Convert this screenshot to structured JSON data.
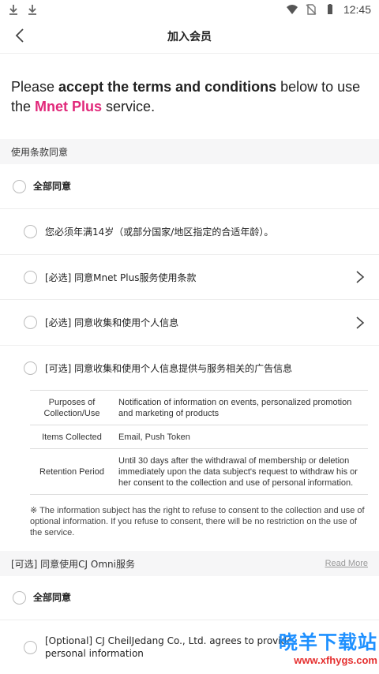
{
  "status_bar": {
    "time": "12:45",
    "left_icons": [
      "download-icon",
      "download-icon"
    ],
    "right_icons": [
      "wifi-icon",
      "no-sim-icon",
      "battery-icon"
    ]
  },
  "header": {
    "title": "加入会员",
    "back_icon": "chevron-left-icon"
  },
  "intro": {
    "part1": "Please ",
    "part2": "accept the terms and conditions",
    "part3": " below to use the ",
    "brand": "Mnet Plus",
    "part4": " service."
  },
  "colors": {
    "brand": "#e1287a",
    "section_bg": "#f6f6f7",
    "divider": "#eeeeee"
  },
  "terms_section": {
    "title": "使用条款同意",
    "agree_all": "全部同意",
    "items": [
      {
        "label": "您必须年满14岁（或部分国家/地区指定的合适年龄）。",
        "has_arrow": false
      },
      {
        "label": "[必选] 同意Mnet Plus服务使用条款",
        "has_arrow": true
      },
      {
        "label": "[必选] 同意收集和使用个人信息",
        "has_arrow": true
      },
      {
        "label": "[可选] 同意收集和使用个人信息提供与服务相关的广告信息",
        "has_arrow": false
      }
    ],
    "table": [
      {
        "key": "Purposes of Collection/Use",
        "value": "Notification of information on events, personalized promotion and marketing of products"
      },
      {
        "key": "Items Collected",
        "value": "Email, Push Token"
      },
      {
        "key": "Retention Period",
        "value": "Until 30 days after the withdrawal of membership or deletion immediately upon the data subject's request to withdraw his or her consent to the collection and use of personal information."
      }
    ],
    "note": "※ The information subject has the right to refuse to consent to the collection and use of optional information. If you refuse to consent, there will be no restriction on the use of the service."
  },
  "cj_section": {
    "title": "[可选] 同意使用CJ Omni服务",
    "read_more": "Read More",
    "agree_all": "全部同意",
    "item": "[Optional] CJ CheilJedang Co., Ltd. agrees to provide personal information"
  },
  "watermark": {
    "main": "晓羊下载站",
    "url": "www.xfhygs.com"
  }
}
